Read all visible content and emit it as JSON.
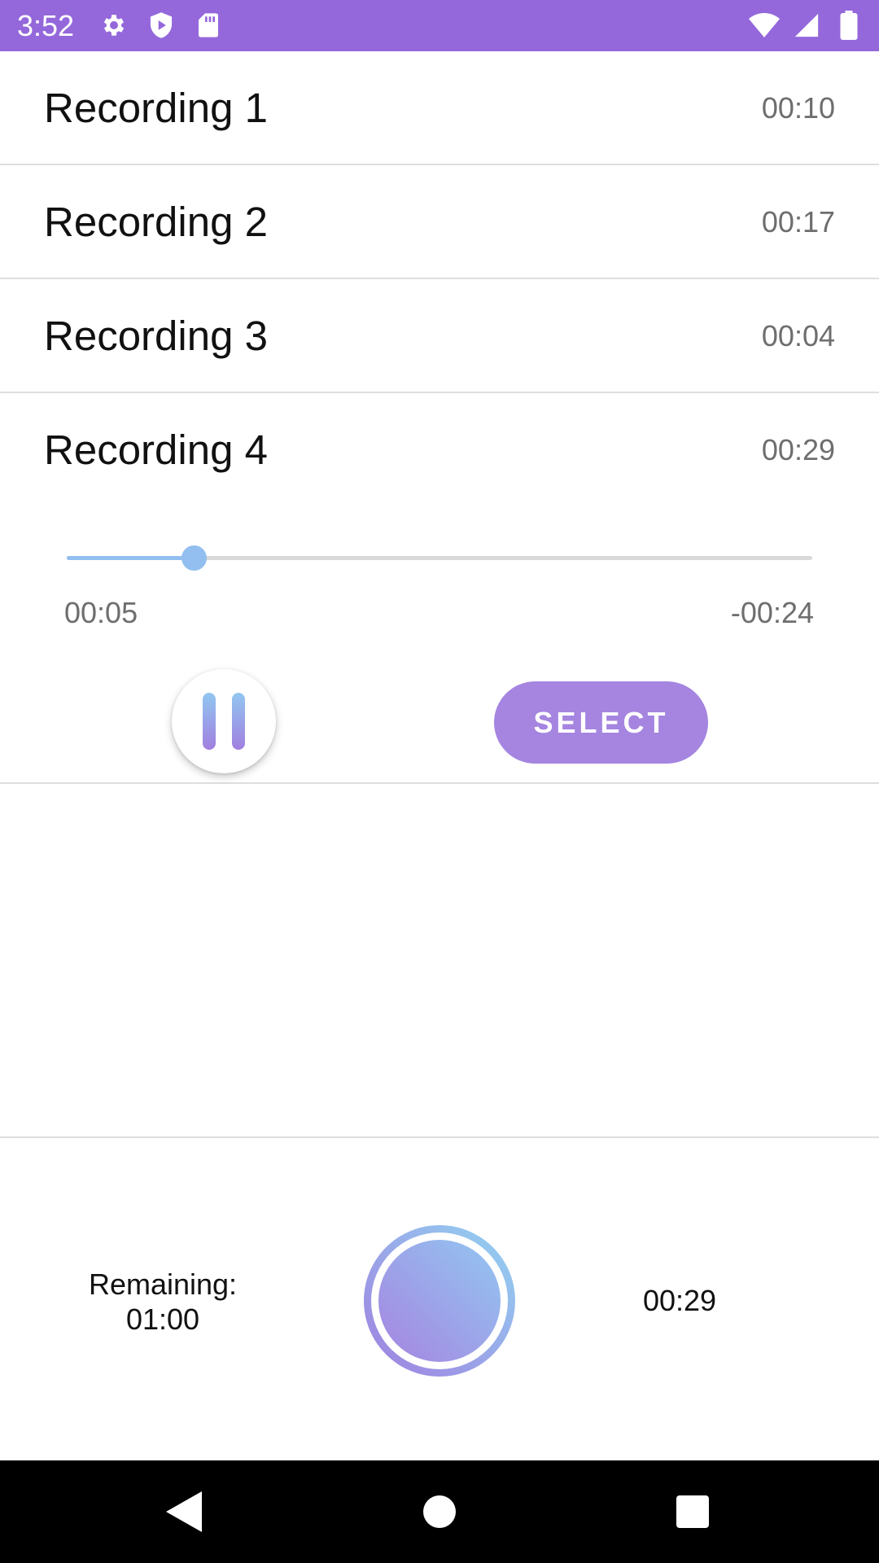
{
  "status_bar": {
    "time": "3:52",
    "background": "#9468db",
    "left_icons": [
      "gear-icon",
      "shield-play-icon",
      "sd-card-icon"
    ],
    "right_icons": [
      "wifi-icon",
      "signal-icon",
      "battery-icon"
    ]
  },
  "recordings": [
    {
      "name": "Recording 1",
      "duration": "00:10"
    },
    {
      "name": "Recording 2",
      "duration": "00:17"
    },
    {
      "name": "Recording 3",
      "duration": "00:04"
    },
    {
      "name": "Recording 4",
      "duration": "00:29"
    }
  ],
  "player": {
    "elapsed": "00:05",
    "remaining": "-00:24",
    "progress_fraction": 0.17,
    "pause_icon": "pause-icon",
    "select_label": "SELECT",
    "accent": "#a585e0",
    "progress_color": "#92bff0"
  },
  "recorder": {
    "remaining_label": "Remaining:",
    "remaining_value": "01:00",
    "elapsed": "00:29",
    "record_icon": "record-button-icon"
  },
  "nav_bar": {
    "icons": [
      "back-icon",
      "home-icon",
      "recents-icon"
    ]
  }
}
